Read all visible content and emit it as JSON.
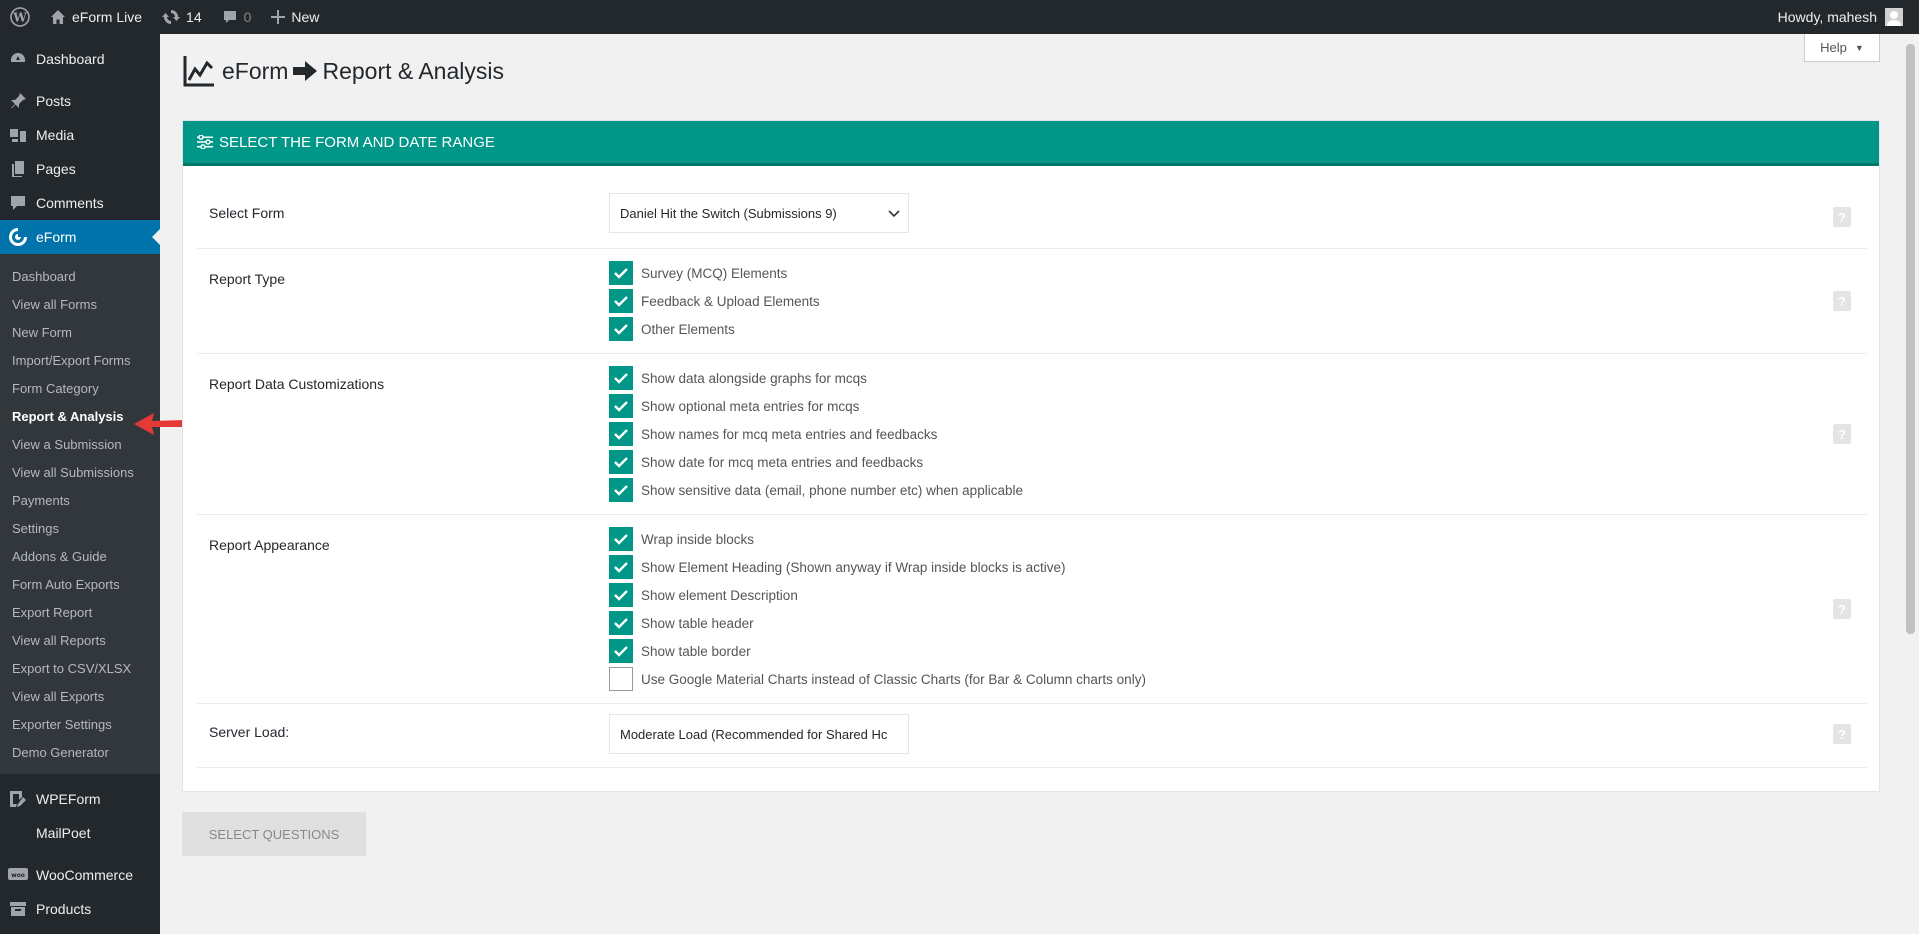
{
  "adminbar": {
    "site_name": "eForm Live",
    "updates_count": "14",
    "comments_count": "0",
    "new_label": "New",
    "howdy": "Howdy, mahesh"
  },
  "sidebar": {
    "dashboard": "Dashboard",
    "posts": "Posts",
    "media": "Media",
    "pages": "Pages",
    "comments": "Comments",
    "eform": "eForm",
    "eform_sub": [
      "Dashboard",
      "View all Forms",
      "New Form",
      "Import/Export Forms",
      "Form Category",
      "Report & Analysis",
      "View a Submission",
      "View all Submissions",
      "Payments",
      "Settings",
      "Addons & Guide",
      "Form Auto Exports",
      "Export Report",
      "View all Reports",
      "Export to CSV/XLSX",
      "View all Exports",
      "Exporter Settings",
      "Demo Generator"
    ],
    "current_index": 5,
    "wpeform": "WPEForm",
    "mailpoet": "MailPoet",
    "woocommerce": "WooCommerce",
    "products": "Products"
  },
  "page": {
    "help_label": "Help",
    "title_left": "eForm",
    "title_right": "Report & Analysis"
  },
  "panel": {
    "header": "SELECT THE FORM AND DATE RANGE",
    "select_form": {
      "label": "Select Form",
      "value": "Daniel Hit the Switch (Submissions 9)"
    },
    "report_type": {
      "label": "Report Type",
      "options": [
        {
          "label": "Survey (MCQ) Elements",
          "checked": true
        },
        {
          "label": "Feedback & Upload Elements",
          "checked": true
        },
        {
          "label": "Other Elements",
          "checked": true
        }
      ]
    },
    "customizations": {
      "label": "Report Data Customizations",
      "options": [
        {
          "label": "Show data alongside graphs for mcqs",
          "checked": true
        },
        {
          "label": "Show optional meta entries for mcqs",
          "checked": true
        },
        {
          "label": "Show names for mcq meta entries and feedbacks",
          "checked": true
        },
        {
          "label": "Show date for mcq meta entries and feedbacks",
          "checked": true
        },
        {
          "label": "Show sensitive data (email, phone number etc) when applicable",
          "checked": true
        }
      ]
    },
    "appearance": {
      "label": "Report Appearance",
      "options": [
        {
          "label": "Wrap inside blocks",
          "checked": true
        },
        {
          "label": "Show Element Heading (Shown anyway if Wrap inside blocks is active)",
          "checked": true
        },
        {
          "label": "Show element Description",
          "checked": true
        },
        {
          "label": "Show table header",
          "checked": true
        },
        {
          "label": "Show table border",
          "checked": true
        },
        {
          "label": "Use Google Material Charts instead of Classic Charts (for Bar & Column charts only)",
          "checked": false
        }
      ]
    },
    "server_load": {
      "label": "Server Load:",
      "value": "Moderate Load (Recommended for Shared Hc"
    },
    "help_glyph": "?"
  },
  "select_questions_label": "SELECT QUESTIONS",
  "colors": {
    "accent": "#009688",
    "wp_blue": "#0073aa",
    "sidebar_bg": "#23282d",
    "arrow_red": "#e53935"
  }
}
